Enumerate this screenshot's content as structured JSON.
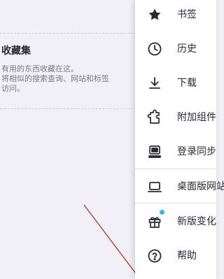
{
  "collection": {
    "title": "收藏集",
    "description_line1": "有用的东西收藏在这。",
    "description_line2": "将相似的搜索查询、网站和标签",
    "description_line3": "访问。"
  },
  "menu": {
    "items": [
      {
        "key": "bookmarks",
        "label": "书签",
        "icon": "star-icon"
      },
      {
        "key": "history",
        "label": "历史",
        "icon": "clock-icon"
      },
      {
        "key": "downloads",
        "label": "下载",
        "icon": "download-icon"
      },
      {
        "key": "addons",
        "label": "附加组件",
        "icon": "puzzle-icon"
      },
      {
        "key": "sync",
        "label": "登录同步",
        "icon": "sync-device-icon"
      },
      {
        "key": "desktop",
        "label": "桌面版网站",
        "icon": "laptop-icon"
      },
      {
        "key": "whats_new",
        "label": "新版变化",
        "icon": "gift-icon"
      },
      {
        "key": "help",
        "label": "帮助",
        "icon": "help-circle-icon"
      }
    ]
  },
  "colors": {
    "background": "#f1f0f6",
    "menu_background": "#ffffff",
    "badge": "#2bb7f0",
    "annotation_arrow": "#c0392b"
  }
}
